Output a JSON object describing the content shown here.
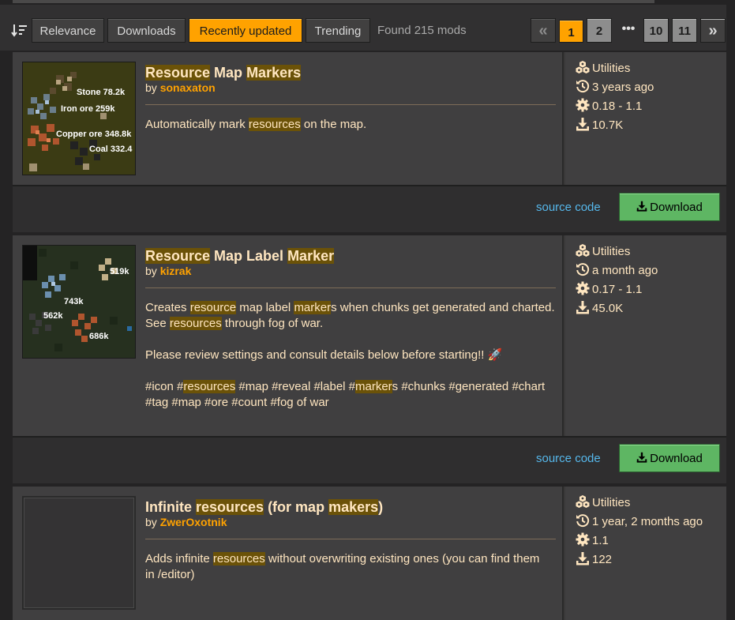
{
  "sort": {
    "labels": [
      "Relevance",
      "Downloads",
      "Recently updated",
      "Trending"
    ],
    "active": "Recently updated",
    "found": "Found 215 mods"
  },
  "pagination": {
    "prev": "«",
    "pages": [
      "1",
      "2"
    ],
    "ellipsis": "•••",
    "last_pages": [
      "10",
      "11"
    ],
    "next": "»",
    "current": "1"
  },
  "mods": [
    {
      "title_parts": [
        {
          "text": "Resource",
          "hl": true
        },
        {
          "text": " Map ",
          "hl": false
        },
        {
          "text": "Markers",
          "hl": true
        }
      ],
      "by": "by",
      "author": "sonaxaton",
      "description_lines": [
        [
          {
            "text": "Automatically mark ",
            "hl": false
          },
          {
            "text": "resources",
            "hl": true
          },
          {
            "text": " on the map.",
            "hl": false
          }
        ]
      ],
      "thumb_labels": [
        "Stone 78.2k",
        "Iron ore 259k",
        "Copper ore 348.8k",
        "Coal 332.4"
      ],
      "category": "Utilities",
      "updated": "3 years ago",
      "versions": "0.18 - 1.1",
      "downloads": "10.7K",
      "source_label": "source code",
      "download_label": "Download"
    },
    {
      "title_parts": [
        {
          "text": "Resource",
          "hl": true
        },
        {
          "text": " Map Label ",
          "hl": false
        },
        {
          "text": "Marker",
          "hl": true
        }
      ],
      "by": "by",
      "author": "kizrak",
      "description_lines": [
        [
          {
            "text": "Creates ",
            "hl": false
          },
          {
            "text": "resource",
            "hl": true
          },
          {
            "text": " map label ",
            "hl": false
          },
          {
            "text": "marker",
            "hl": true
          },
          {
            "text": "s when chunks get generated and charted.",
            "hl": false
          }
        ],
        [
          {
            "text": "See ",
            "hl": false
          },
          {
            "text": "resources",
            "hl": true
          },
          {
            "text": " through fog of war.",
            "hl": false
          }
        ],
        [],
        [
          {
            "text": "Please review settings and consult details below before starting!! 🚀",
            "hl": false
          }
        ],
        [],
        [
          {
            "text": "#icon #",
            "hl": false
          },
          {
            "text": "resources",
            "hl": true
          },
          {
            "text": " #map #reveal #label #",
            "hl": false
          },
          {
            "text": "marker",
            "hl": true
          },
          {
            "text": "s #chunks #generated #chart",
            "hl": false
          }
        ],
        [
          {
            "text": "#tag #map #ore #count #fog of war",
            "hl": false
          }
        ]
      ],
      "thumb_labels": [
        "519k",
        "743k",
        "562k",
        "686k"
      ],
      "category": "Utilities",
      "updated": "a month ago",
      "versions": "0.17 - 1.1",
      "downloads": "45.0K",
      "source_label": "source code",
      "download_label": "Download"
    },
    {
      "title_parts": [
        {
          "text": "Infinite ",
          "hl": false
        },
        {
          "text": "resources",
          "hl": true
        },
        {
          "text": " (for map ",
          "hl": false
        },
        {
          "text": "makers",
          "hl": true
        },
        {
          "text": ")",
          "hl": false
        }
      ],
      "by": "by",
      "author": "ZwerOxotnik",
      "description_lines": [
        [
          {
            "text": "Adds infinite ",
            "hl": false
          },
          {
            "text": "resources",
            "hl": true
          },
          {
            "text": " without overwriting existing ones (you can find them",
            "hl": false
          }
        ],
        [
          {
            "text": "in /editor)",
            "hl": false
          }
        ]
      ],
      "category": "Utilities",
      "updated": "1 year, 2 months ago",
      "versions": "1.1",
      "downloads": "122"
    }
  ],
  "colors": {
    "accent": "#ffa200",
    "highlight": "#6b5208",
    "download_green": "#5eb663",
    "link": "#56b8ec",
    "text": "#ffe6c0"
  }
}
